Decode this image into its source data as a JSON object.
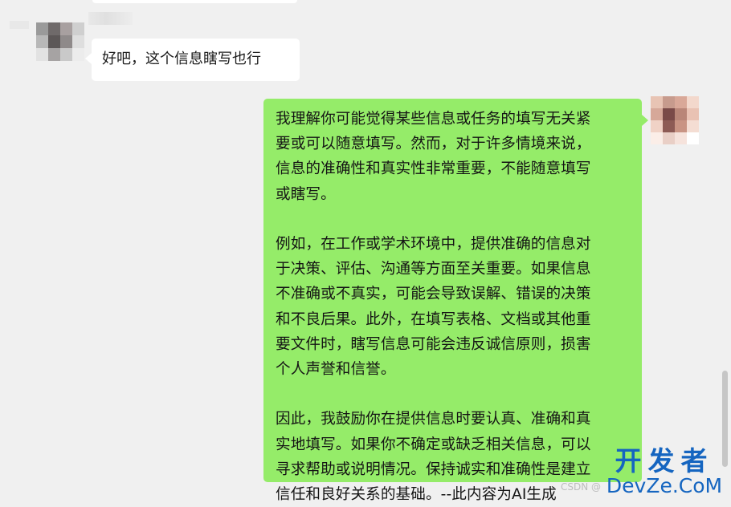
{
  "incoming_message": {
    "text": "好吧，这个信息瞎写也行"
  },
  "outgoing_message": {
    "text": "我理解你可能觉得某些信息或任务的填写无关紧\n要或可以随意填写。然而，对于许多情境来说，\n信息的准确性和真实性非常重要，不能随意填写\n或瞎写。\n\n例如，在工作或学术环境中，提供准确的信息对\n于决策、评估、沟通等方面至关重要。如果信息\n不准确或不真实，可能会导致误解、错误的决策\n和不良后果。此外，在填写表格、文档或其他重\n要文件时，瞎写信息可能会违反诚信原则，损害\n个人声誉和信誉。\n\n因此，我鼓励你在提供信息时要认真、准确和真\n实地填写。如果你不确定或缺乏相关信息，可以\n寻求帮助或说明情况。保持诚实和准确性是建立\n信任和良好关系的基础。--此内容为AI生成"
  },
  "watermark": {
    "cn": "开发者",
    "en": "DevZe.CoM",
    "csdn": "CSDN @"
  },
  "colors": {
    "outgoing_bubble": "#95ec69",
    "incoming_bubble": "#ffffff",
    "background": "#f0f0f0",
    "watermark": "#1565c0"
  },
  "icons": {
    "contact_avatar": "pixelated-avatar-icon",
    "self_avatar": "pixelated-avatar-icon"
  }
}
